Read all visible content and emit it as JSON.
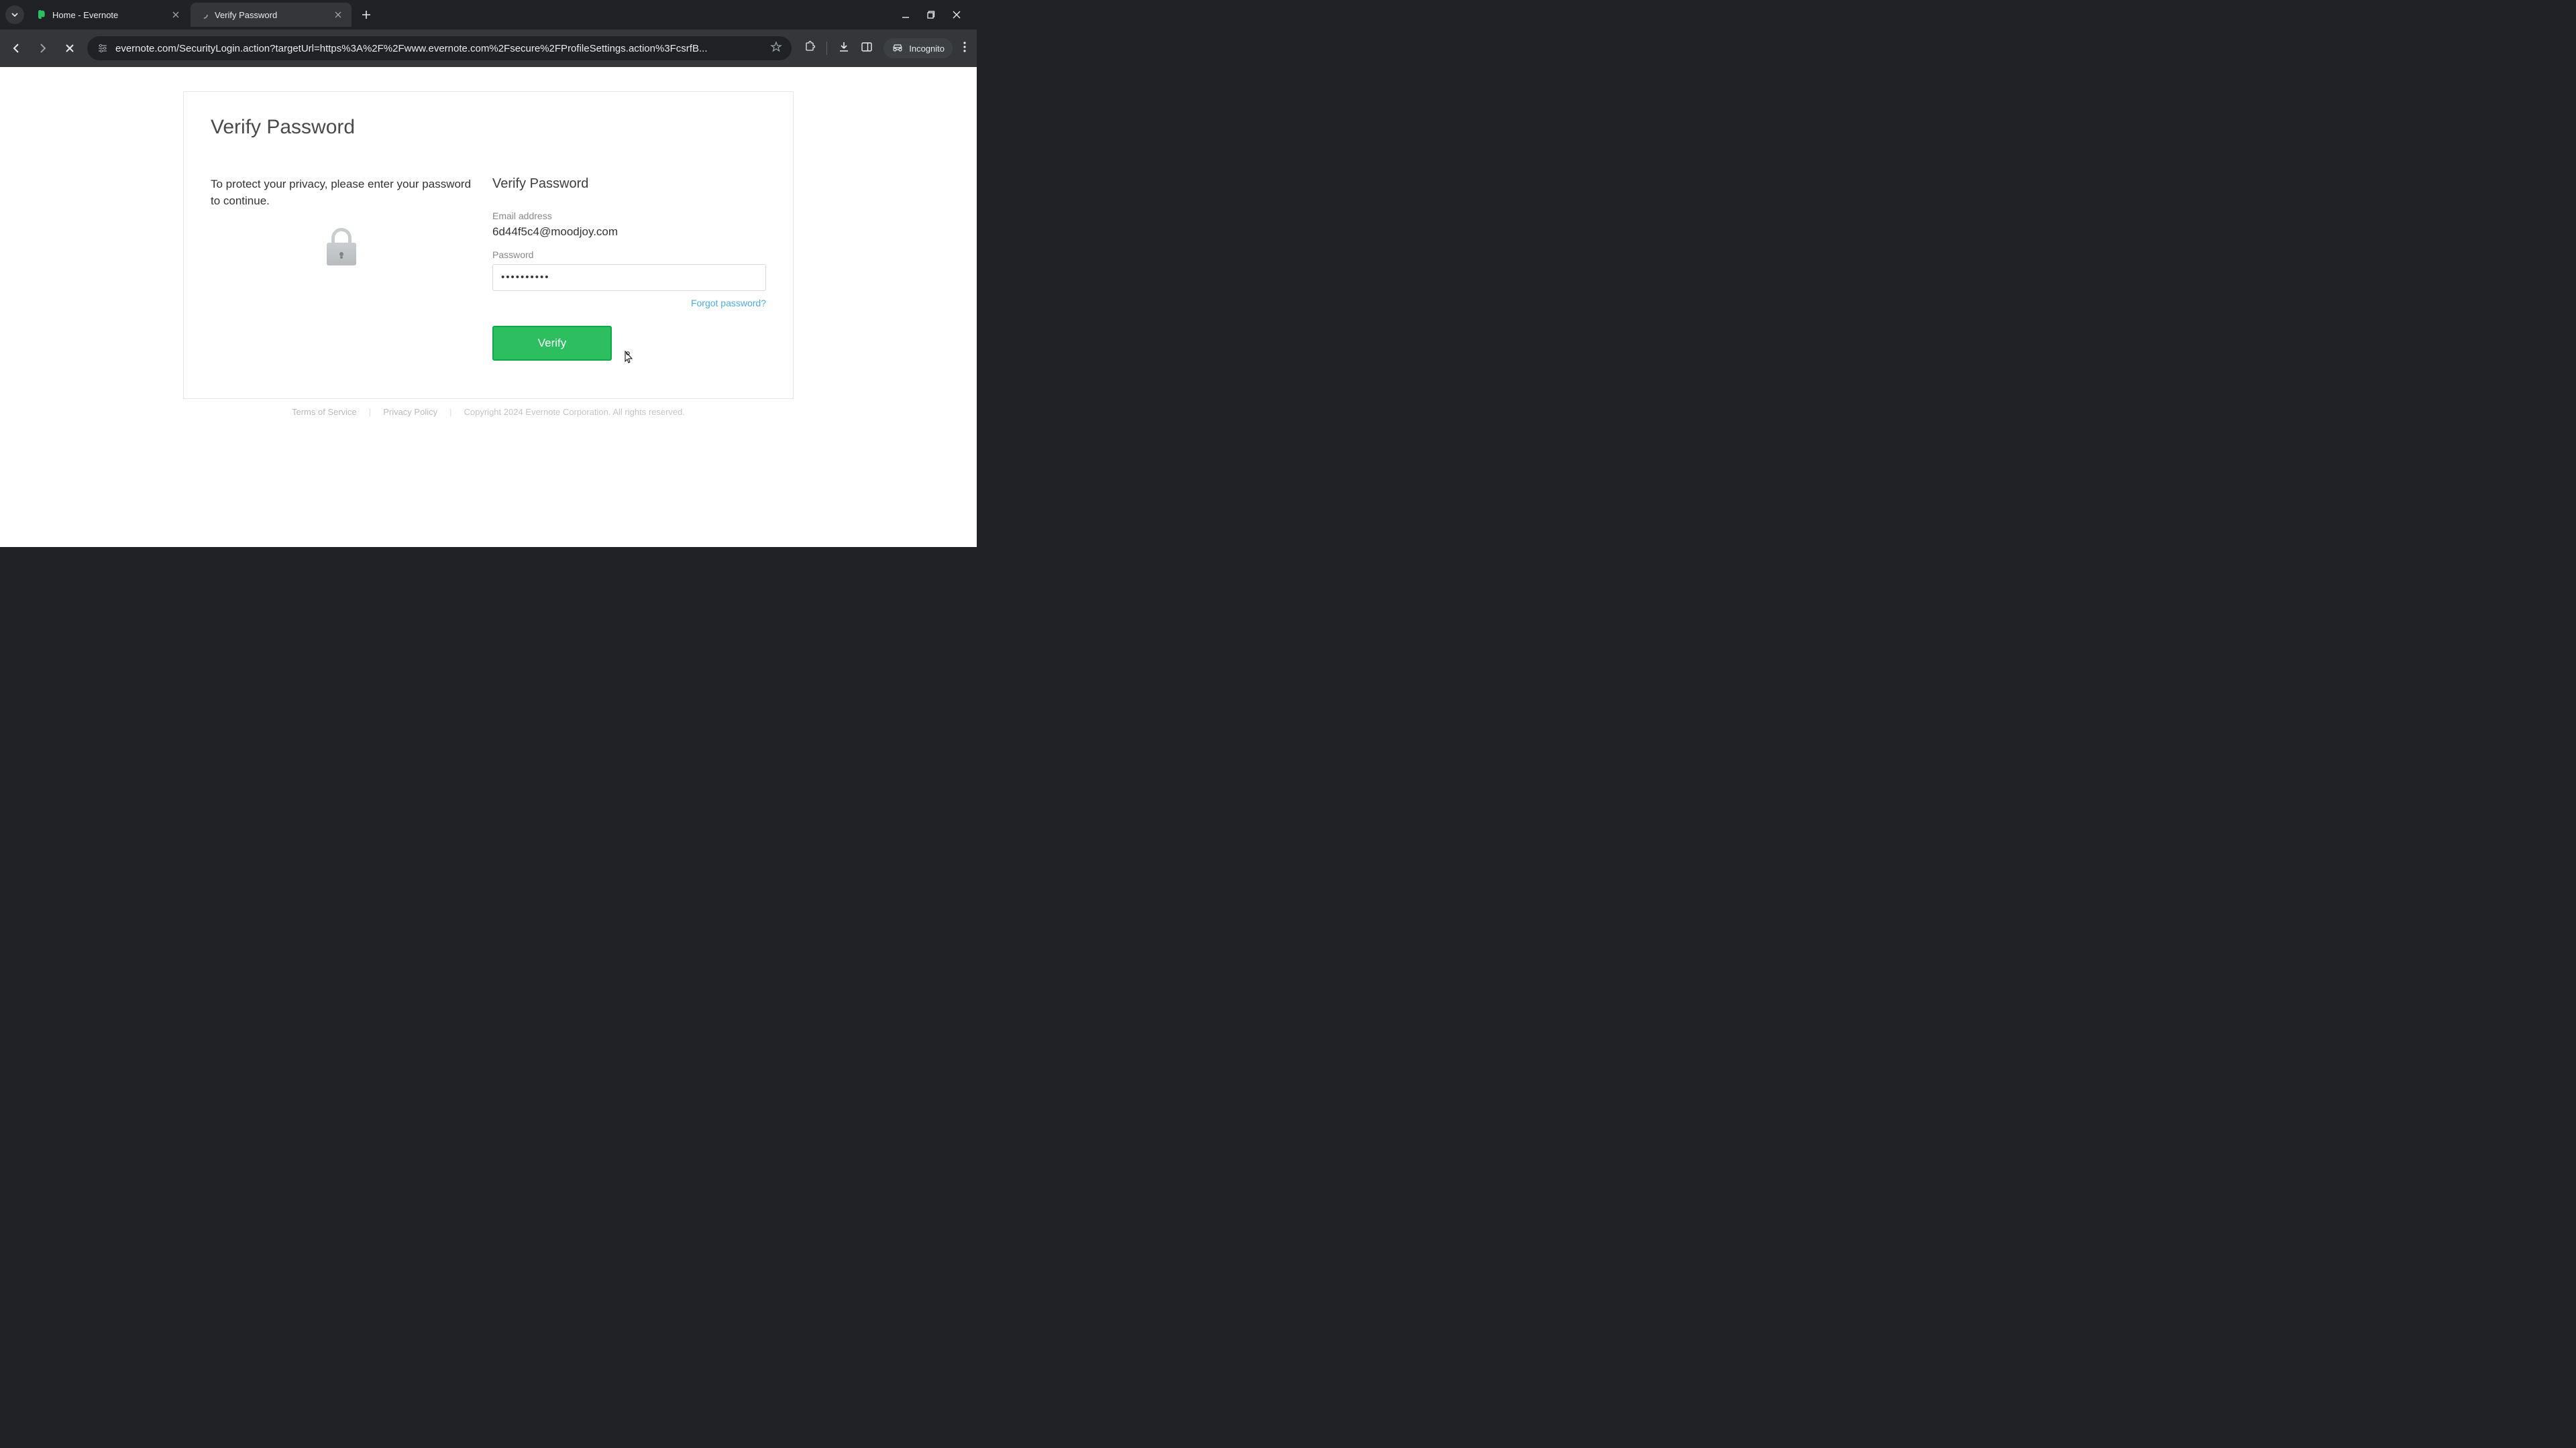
{
  "browser": {
    "tabs": [
      {
        "title": "Home - Evernote",
        "active": false
      },
      {
        "title": "Verify Password",
        "active": true
      }
    ],
    "url": "evernote.com/SecurityLogin.action?targetUrl=https%3A%2F%2Fwww.evernote.com%2Fsecure%2FProfileSettings.action%3FcsrfB...",
    "incognito_label": "Incognito"
  },
  "page": {
    "heading": "Verify Password",
    "prompt": "To protect your privacy, please enter your password to continue.",
    "form": {
      "subheading": "Verify Password",
      "email_label": "Email address",
      "email_value": "6d44f5c4@moodjoy.com",
      "password_label": "Password",
      "password_value": "••••••••••",
      "forgot_label": "Forgot password?",
      "verify_label": "Verify"
    }
  },
  "footer": {
    "terms": "Terms of Service",
    "privacy": "Privacy Policy",
    "copyright": "Copyright 2024 Evernote Corporation. All rights reserved."
  },
  "colors": {
    "accent_green": "#2dbe60",
    "link_blue": "#4eaadc"
  }
}
